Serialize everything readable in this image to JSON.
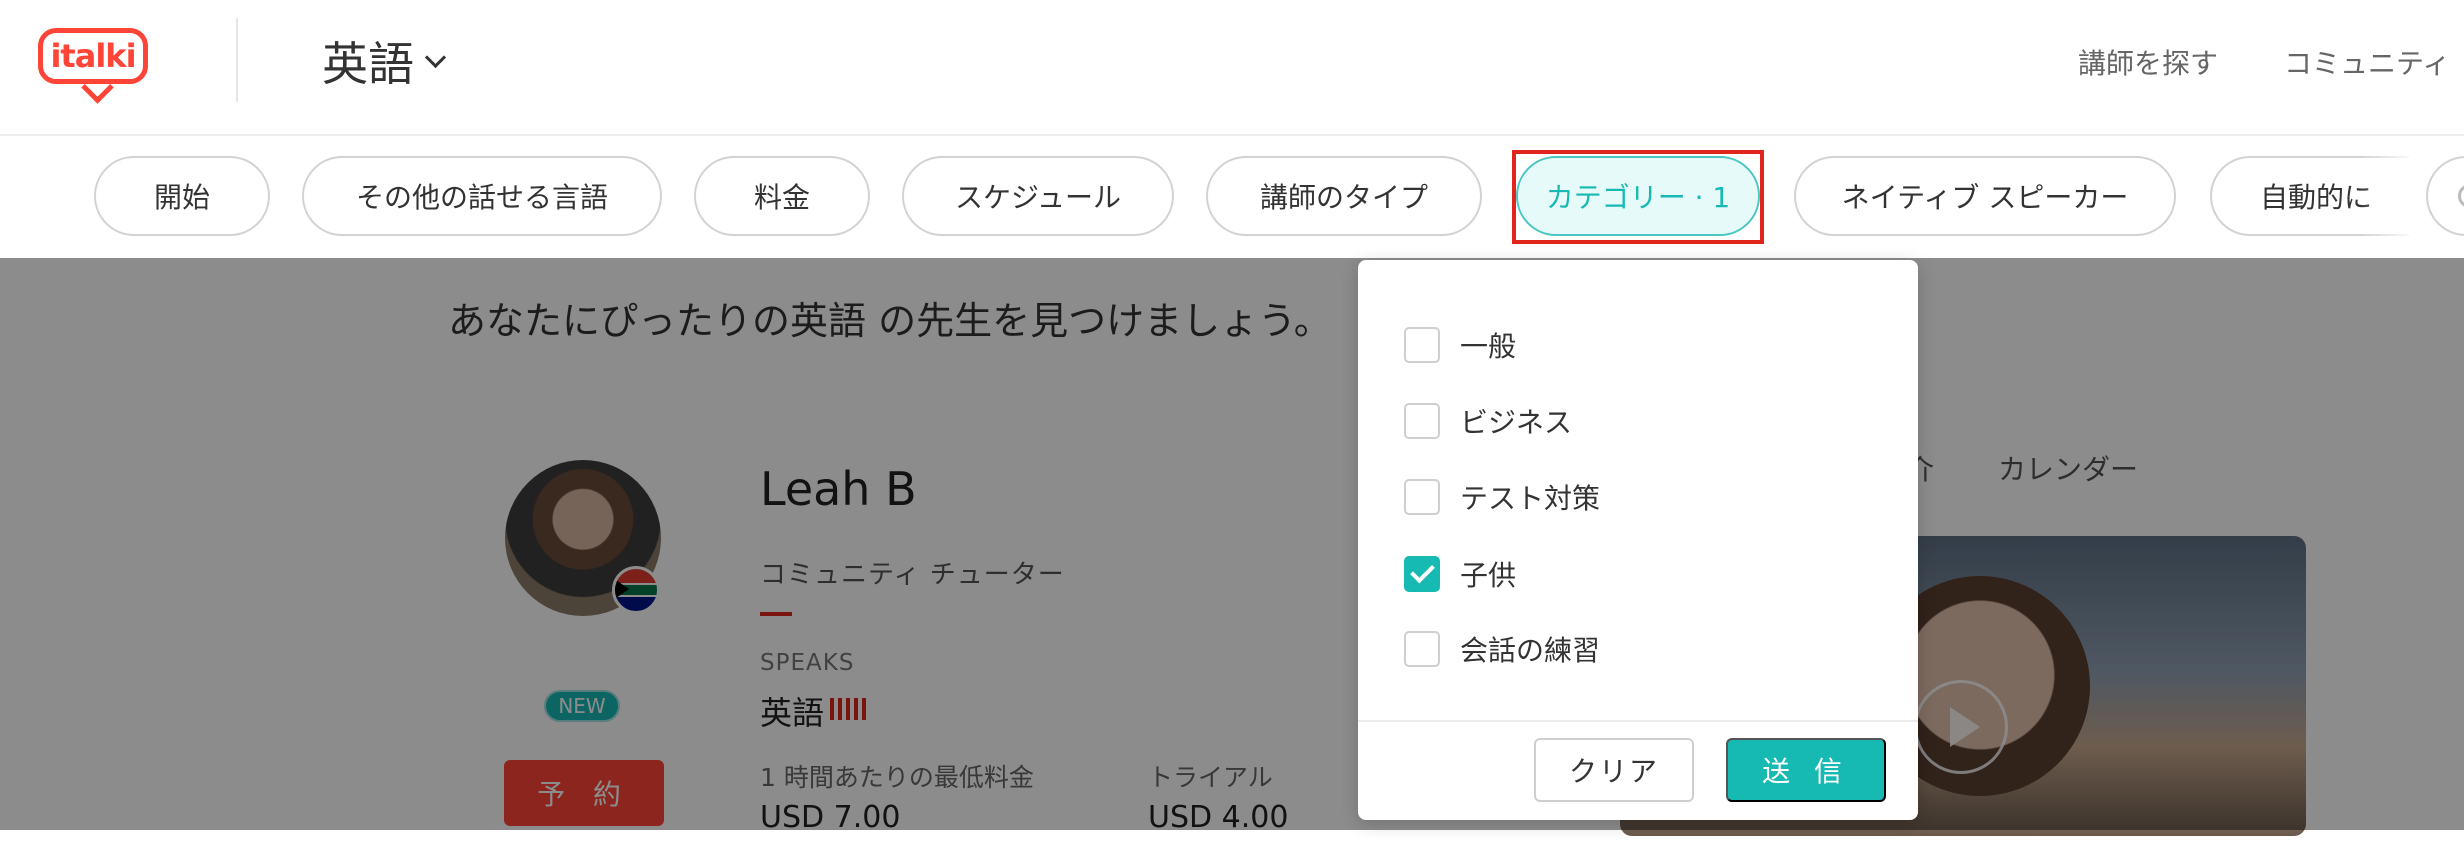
{
  "header": {
    "logo_text": "italki",
    "language": "英語",
    "nav": [
      "講師を探す",
      "コミュニティ"
    ]
  },
  "filters": [
    {
      "label": "開始",
      "active": false
    },
    {
      "label": "その他の話せる言語",
      "active": false
    },
    {
      "label": "料金",
      "active": false
    },
    {
      "label": "スケジュール",
      "active": false
    },
    {
      "label": "講師のタイプ",
      "active": false
    },
    {
      "label": "カテゴリー · 1",
      "active": true
    },
    {
      "label": "ネイティブ スピーカー",
      "active": false
    },
    {
      "label": "自動的に",
      "active": false
    }
  ],
  "main": {
    "headline": "あなたにぴったりの英語 の先生を見つけましょう。"
  },
  "tutor": {
    "name": "Leah B",
    "type": "コミュニティ チューター",
    "speaks_label": "SPEAKS",
    "speaks_language": "英語",
    "new_badge": "NEW",
    "book_label": "予 約",
    "min_price_label": "1 時間あたりの最低料金",
    "min_price": "USD 7.00",
    "trial_label": "トライアル",
    "trial_price": "USD 4.00",
    "tabs": [
      "介",
      "カレンダー"
    ]
  },
  "dropdown": {
    "options": [
      {
        "label": "一般",
        "checked": false
      },
      {
        "label": "ビジネス",
        "checked": false
      },
      {
        "label": "テスト対策",
        "checked": false
      },
      {
        "label": "子供",
        "checked": true
      },
      {
        "label": "会話の練習",
        "checked": false
      }
    ],
    "clear_label": "クリア",
    "submit_label": "送 信"
  },
  "colors": {
    "brand": "#ff4438",
    "accent": "#17b9b3",
    "highlight": "#e0261c"
  }
}
